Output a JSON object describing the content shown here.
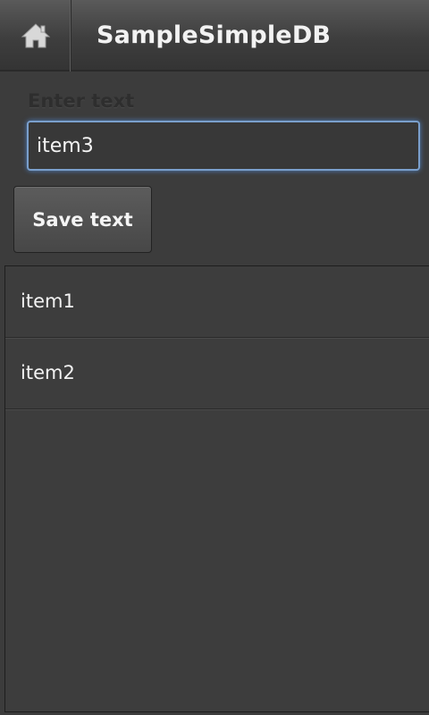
{
  "action_bar": {
    "title": "SampleSimpleDB",
    "home_icon": "home-icon"
  },
  "form": {
    "label": "Enter text",
    "input_value": "item3",
    "save_label": "Save text"
  },
  "list": {
    "items": [
      "item1",
      "item2"
    ]
  },
  "colors": {
    "background": "#3c3c3c",
    "focus_border": "#7a9fcc",
    "text": "#f2f2f2"
  }
}
